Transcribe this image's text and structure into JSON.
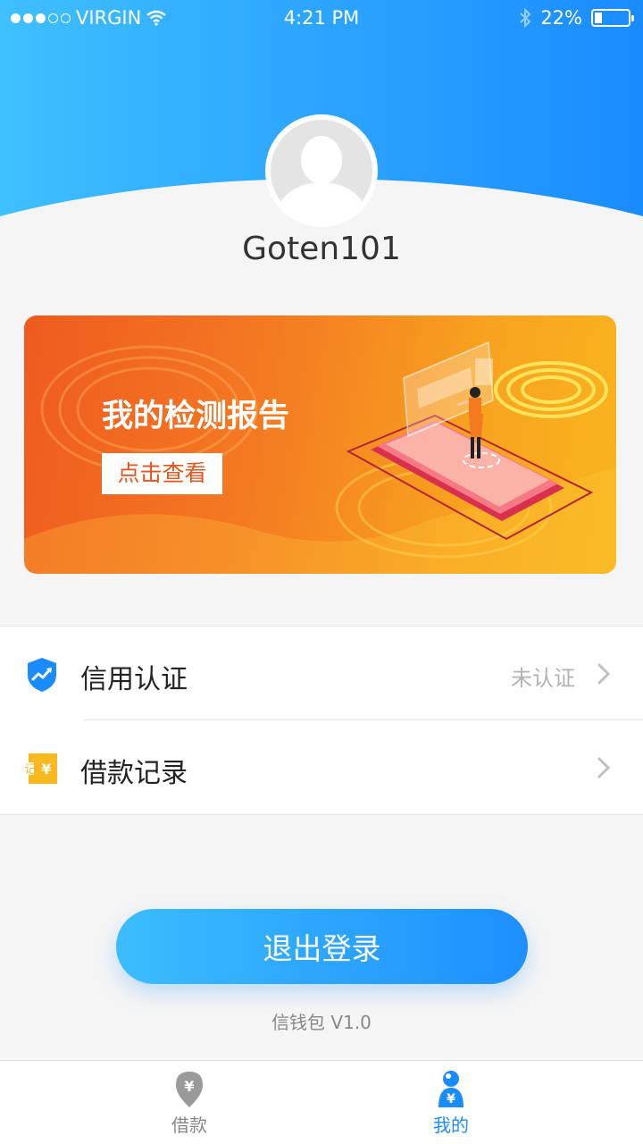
{
  "status_bar": {
    "carrier": "VIRGIN",
    "time": "4:21 PM",
    "battery_text": "22%",
    "battery_level": 0.22,
    "signal_dots_filled": 3,
    "signal_dots_total": 5
  },
  "profile": {
    "username": "Goten101"
  },
  "banner": {
    "title": "我的检测报告",
    "button_label": "点击查看"
  },
  "menu": {
    "items": [
      {
        "label": "信用认证",
        "status": "未认证",
        "icon": "shield-chart-icon"
      },
      {
        "label": "借款记录",
        "status": "",
        "icon": "yen-ticket-icon"
      }
    ]
  },
  "logout_label": "退出登录",
  "version_text": "信钱包 V1.0",
  "tabbar": {
    "tabs": [
      {
        "label": "借款",
        "icon": "yen-pin-icon",
        "active": false
      },
      {
        "label": "我的",
        "icon": "user-yen-icon",
        "active": true
      }
    ]
  },
  "colors": {
    "primary": "#1a8cff",
    "header_light": "#3fc0ff",
    "banner_orange": "#f47a22",
    "banner_yellow": "#f9b51e",
    "ticket_yellow": "#f9b81d"
  }
}
